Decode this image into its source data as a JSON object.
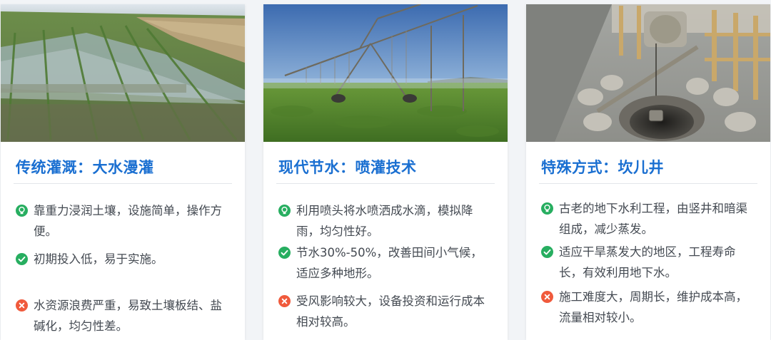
{
  "cards": [
    {
      "title": "传统灌溉：大水漫灌",
      "points": [
        {
          "icon": "lightbulb-icon",
          "text": "靠重力浸润土壤，设施简单，操作方便。"
        },
        {
          "icon": "check-circle-icon",
          "text": "初期投入低，易于实施。"
        },
        {
          "icon": "x-circle-icon",
          "text": "水资源浪费严重，易致土壤板结、盐碱化，均匀性差。"
        }
      ]
    },
    {
      "title": "现代节水：喷灌技术",
      "points": [
        {
          "icon": "lightbulb-icon",
          "text": "利用喷头将水喷洒成水滴，模拟降雨，均匀性好。"
        },
        {
          "icon": "check-circle-icon",
          "text": "节水30%-50%，改善田间小气候，适应多种地形。"
        },
        {
          "icon": "x-circle-icon",
          "text": "受风影响较大，设备投资和运行成本相对较高。"
        }
      ]
    },
    {
      "title": "特殊方式：坎儿井",
      "points": [
        {
          "icon": "lightbulb-icon",
          "text": "古老的地下水利工程，由竖井和暗渠组成，减少蒸发。"
        },
        {
          "icon": "check-circle-icon",
          "text": "适应干旱蒸发大的地区，工程寿命长，有效利用地下水。"
        },
        {
          "icon": "x-circle-icon",
          "text": "施工难度大，周期长，维护成本高，流量相对较小。"
        }
      ]
    }
  ],
  "colors": {
    "title": "#1a6fd1",
    "bulb": "#27ae60",
    "check": "#27ae60",
    "cross": "#f05a3c",
    "text": "#444a52"
  }
}
